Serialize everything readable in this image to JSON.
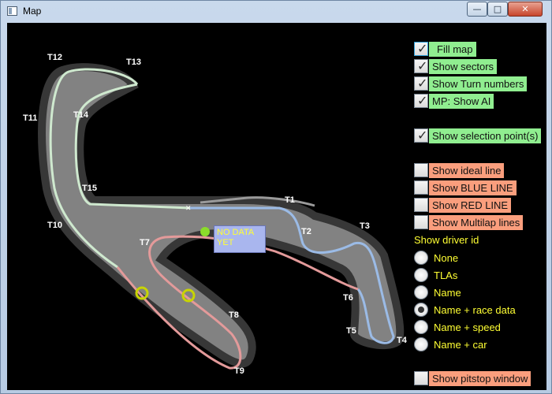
{
  "window": {
    "title": "Map",
    "min_glyph": "—",
    "max_glyph": "□",
    "close_glyph": "✕"
  },
  "map": {
    "turns": [
      "T1",
      "T2",
      "T3",
      "T4",
      "T5",
      "T6",
      "T7",
      "T8",
      "T9",
      "T10",
      "T11",
      "T12",
      "T13",
      "T14",
      "T15"
    ],
    "no_data_label_line1": "NO DATA",
    "no_data_label_line2": "YET",
    "colors": {
      "sector1": "#9bbbe6",
      "sector2": "#e39a9a",
      "sector3": "#bfe8bf",
      "track_fill": "#8a8a8a",
      "selection_point": "#c8d400",
      "marker": "#8bdc2a"
    }
  },
  "options": {
    "fill_map": {
      "label": "Fill map",
      "checked": true
    },
    "show_sectors": {
      "label": "Show sectors",
      "checked": true
    },
    "show_turn_numbers": {
      "label": "Show Turn numbers",
      "checked": true
    },
    "mp_show_ai": {
      "label": "MP: Show AI",
      "checked": true
    },
    "show_selection_points": {
      "label": "Show selection point(s)",
      "checked": true
    },
    "show_ideal_line": {
      "label": "Show ideal line",
      "checked": false
    },
    "show_blue_line": {
      "label": "Show BLUE LINE",
      "checked": false
    },
    "show_red_line": {
      "label": "Show RED LINE",
      "checked": false
    },
    "show_multilap_lines": {
      "label": "Show Multilap lines",
      "checked": false
    },
    "show_pitstop_window": {
      "label": "Show pitstop window",
      "checked": false
    }
  },
  "driver_id": {
    "heading": "Show driver id",
    "options": [
      "None",
      "TLAs",
      "Name",
      "Name + race data",
      "Name + speed",
      "Name + car"
    ],
    "selected": "Name + race data"
  },
  "check_glyph": "✓"
}
